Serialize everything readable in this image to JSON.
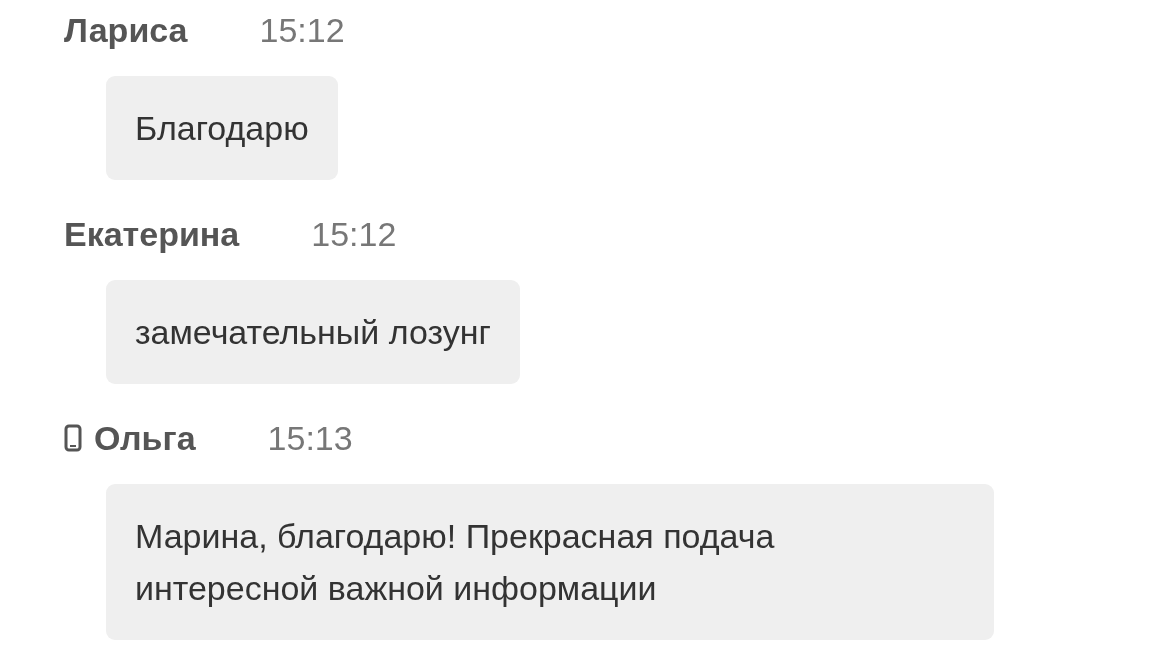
{
  "messages": [
    {
      "author": "Лариса",
      "time": "15:12",
      "mobile": false,
      "text": "Благодарю"
    },
    {
      "author": "Екатерина",
      "time": "15:12",
      "mobile": false,
      "text": "замечательный лозунг"
    },
    {
      "author": "Ольга",
      "time": "15:13",
      "mobile": true,
      "text": "Марина, благодарю! Прекрасная подача интересной важной информации"
    }
  ]
}
